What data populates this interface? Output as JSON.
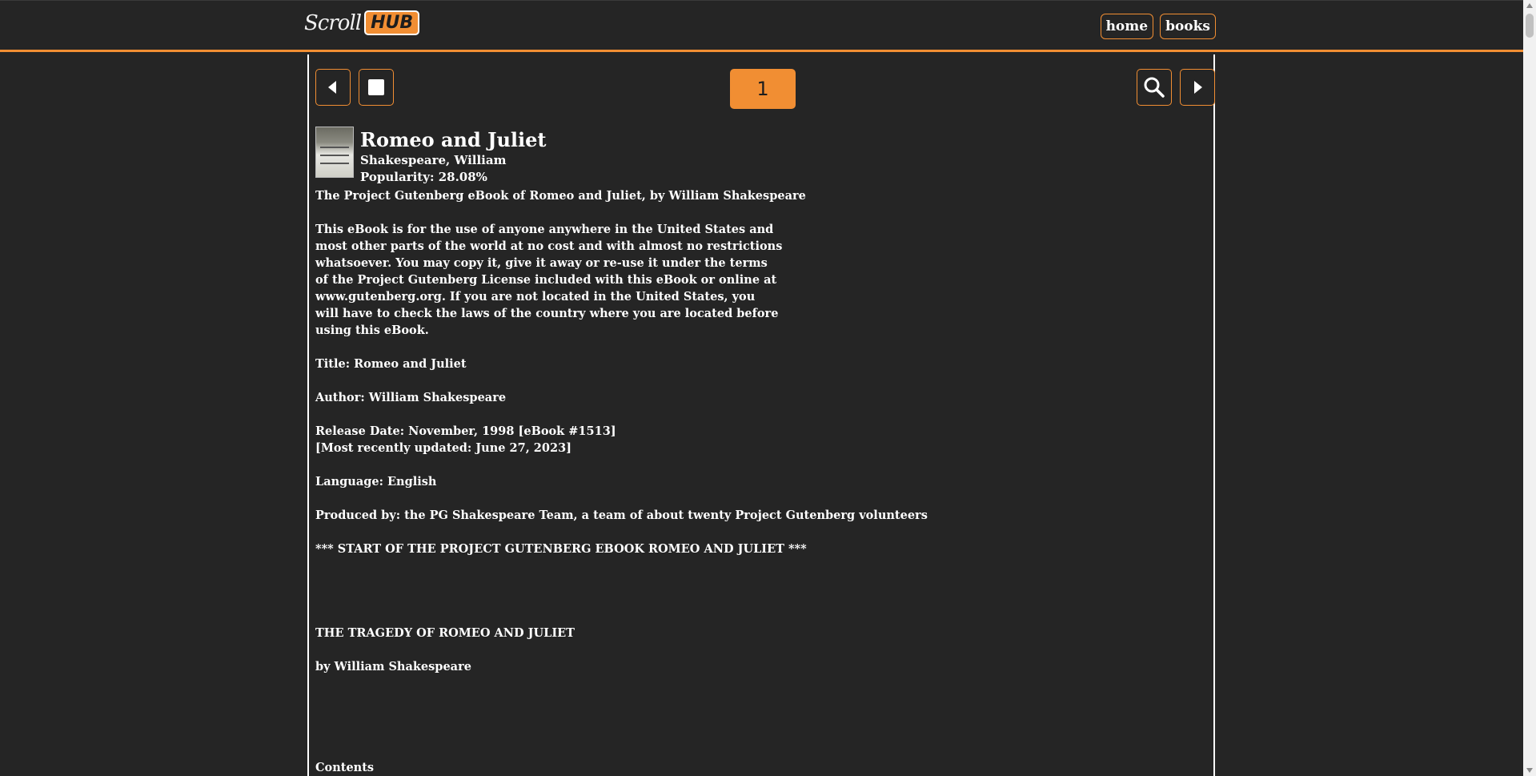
{
  "header": {
    "logo_script": "Scroll",
    "logo_badge": "HUB",
    "nav": [
      {
        "label": "home"
      },
      {
        "label": "books"
      }
    ]
  },
  "toolbar": {
    "page_number": "1",
    "icons": [
      "prev-arrow-icon",
      "stop-icon",
      "search-icon",
      "next-arrow-icon"
    ]
  },
  "book": {
    "title": "Romeo and Juliet",
    "author": "Shakespeare, William",
    "popularity": "Popularity: 28.08%"
  },
  "body_text": "The Project Gutenberg eBook of Romeo and Juliet, by William Shakespeare\n\nThis eBook is for the use of anyone anywhere in the United States and\nmost other parts of the world at no cost and with almost no restrictions\nwhatsoever. You may copy it, give it away or re-use it under the terms\nof the Project Gutenberg License included with this eBook or online at\nwww.gutenberg.org. If you are not located in the United States, you\nwill have to check the laws of the country where you are located before\nusing this eBook.\n\nTitle: Romeo and Juliet\n\nAuthor: William Shakespeare\n\nRelease Date: November, 1998 [eBook #1513]\n[Most recently updated: June 27, 2023]\n\nLanguage: English\n\nProduced by: the PG Shakespeare Team, a team of about twenty Project Gutenberg volunteers\n\n*** START OF THE PROJECT GUTENBERG EBOOK ROMEO AND JULIET ***\n\n\n\n\nTHE TRAGEDY OF ROMEO AND JULIET\n\nby William Shakespeare\n\n\n\n\n\nContents",
  "colors": {
    "accent": "#f18e33",
    "background": "#252525",
    "text": "#ffffff"
  }
}
